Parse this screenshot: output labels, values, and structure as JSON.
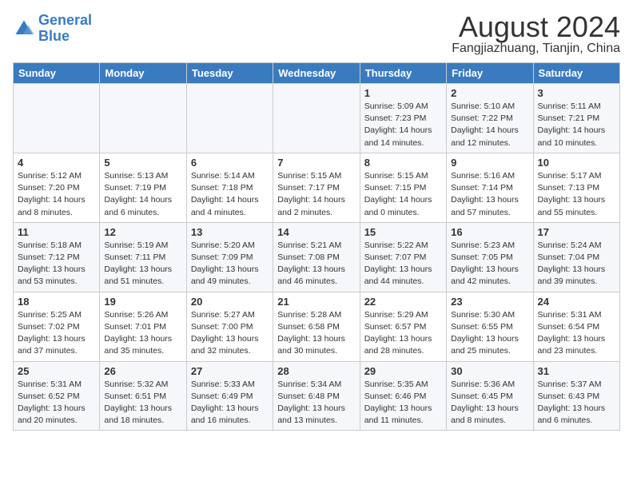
{
  "header": {
    "logo_line1": "General",
    "logo_line2": "Blue",
    "month": "August 2024",
    "location": "Fangjiazhuang, Tianjin, China"
  },
  "weekdays": [
    "Sunday",
    "Monday",
    "Tuesday",
    "Wednesday",
    "Thursday",
    "Friday",
    "Saturday"
  ],
  "weeks": [
    [
      {
        "day": "",
        "info": ""
      },
      {
        "day": "",
        "info": ""
      },
      {
        "day": "",
        "info": ""
      },
      {
        "day": "",
        "info": ""
      },
      {
        "day": "1",
        "info": "Sunrise: 5:09 AM\nSunset: 7:23 PM\nDaylight: 14 hours\nand 14 minutes."
      },
      {
        "day": "2",
        "info": "Sunrise: 5:10 AM\nSunset: 7:22 PM\nDaylight: 14 hours\nand 12 minutes."
      },
      {
        "day": "3",
        "info": "Sunrise: 5:11 AM\nSunset: 7:21 PM\nDaylight: 14 hours\nand 10 minutes."
      }
    ],
    [
      {
        "day": "4",
        "info": "Sunrise: 5:12 AM\nSunset: 7:20 PM\nDaylight: 14 hours\nand 8 minutes."
      },
      {
        "day": "5",
        "info": "Sunrise: 5:13 AM\nSunset: 7:19 PM\nDaylight: 14 hours\nand 6 minutes."
      },
      {
        "day": "6",
        "info": "Sunrise: 5:14 AM\nSunset: 7:18 PM\nDaylight: 14 hours\nand 4 minutes."
      },
      {
        "day": "7",
        "info": "Sunrise: 5:15 AM\nSunset: 7:17 PM\nDaylight: 14 hours\nand 2 minutes."
      },
      {
        "day": "8",
        "info": "Sunrise: 5:15 AM\nSunset: 7:15 PM\nDaylight: 14 hours\nand 0 minutes."
      },
      {
        "day": "9",
        "info": "Sunrise: 5:16 AM\nSunset: 7:14 PM\nDaylight: 13 hours\nand 57 minutes."
      },
      {
        "day": "10",
        "info": "Sunrise: 5:17 AM\nSunset: 7:13 PM\nDaylight: 13 hours\nand 55 minutes."
      }
    ],
    [
      {
        "day": "11",
        "info": "Sunrise: 5:18 AM\nSunset: 7:12 PM\nDaylight: 13 hours\nand 53 minutes."
      },
      {
        "day": "12",
        "info": "Sunrise: 5:19 AM\nSunset: 7:11 PM\nDaylight: 13 hours\nand 51 minutes."
      },
      {
        "day": "13",
        "info": "Sunrise: 5:20 AM\nSunset: 7:09 PM\nDaylight: 13 hours\nand 49 minutes."
      },
      {
        "day": "14",
        "info": "Sunrise: 5:21 AM\nSunset: 7:08 PM\nDaylight: 13 hours\nand 46 minutes."
      },
      {
        "day": "15",
        "info": "Sunrise: 5:22 AM\nSunset: 7:07 PM\nDaylight: 13 hours\nand 44 minutes."
      },
      {
        "day": "16",
        "info": "Sunrise: 5:23 AM\nSunset: 7:05 PM\nDaylight: 13 hours\nand 42 minutes."
      },
      {
        "day": "17",
        "info": "Sunrise: 5:24 AM\nSunset: 7:04 PM\nDaylight: 13 hours\nand 39 minutes."
      }
    ],
    [
      {
        "day": "18",
        "info": "Sunrise: 5:25 AM\nSunset: 7:02 PM\nDaylight: 13 hours\nand 37 minutes."
      },
      {
        "day": "19",
        "info": "Sunrise: 5:26 AM\nSunset: 7:01 PM\nDaylight: 13 hours\nand 35 minutes."
      },
      {
        "day": "20",
        "info": "Sunrise: 5:27 AM\nSunset: 7:00 PM\nDaylight: 13 hours\nand 32 minutes."
      },
      {
        "day": "21",
        "info": "Sunrise: 5:28 AM\nSunset: 6:58 PM\nDaylight: 13 hours\nand 30 minutes."
      },
      {
        "day": "22",
        "info": "Sunrise: 5:29 AM\nSunset: 6:57 PM\nDaylight: 13 hours\nand 28 minutes."
      },
      {
        "day": "23",
        "info": "Sunrise: 5:30 AM\nSunset: 6:55 PM\nDaylight: 13 hours\nand 25 minutes."
      },
      {
        "day": "24",
        "info": "Sunrise: 5:31 AM\nSunset: 6:54 PM\nDaylight: 13 hours\nand 23 minutes."
      }
    ],
    [
      {
        "day": "25",
        "info": "Sunrise: 5:31 AM\nSunset: 6:52 PM\nDaylight: 13 hours\nand 20 minutes."
      },
      {
        "day": "26",
        "info": "Sunrise: 5:32 AM\nSunset: 6:51 PM\nDaylight: 13 hours\nand 18 minutes."
      },
      {
        "day": "27",
        "info": "Sunrise: 5:33 AM\nSunset: 6:49 PM\nDaylight: 13 hours\nand 16 minutes."
      },
      {
        "day": "28",
        "info": "Sunrise: 5:34 AM\nSunset: 6:48 PM\nDaylight: 13 hours\nand 13 minutes."
      },
      {
        "day": "29",
        "info": "Sunrise: 5:35 AM\nSunset: 6:46 PM\nDaylight: 13 hours\nand 11 minutes."
      },
      {
        "day": "30",
        "info": "Sunrise: 5:36 AM\nSunset: 6:45 PM\nDaylight: 13 hours\nand 8 minutes."
      },
      {
        "day": "31",
        "info": "Sunrise: 5:37 AM\nSunset: 6:43 PM\nDaylight: 13 hours\nand 6 minutes."
      }
    ]
  ]
}
